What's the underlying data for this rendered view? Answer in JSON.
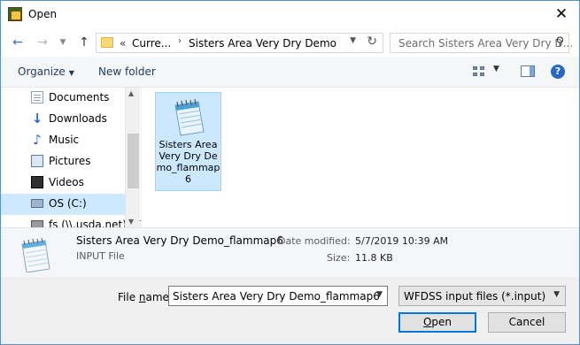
{
  "window": {
    "title": "Open",
    "close_glyph": "✕"
  },
  "nav": {
    "breadcrumb_prefix": "«",
    "breadcrumb_parent": "Curre...",
    "breadcrumb_separator": "›",
    "breadcrumb_current": "Sisters Area Very Dry Demo",
    "search_placeholder": "Search Sisters Area Very Dry D..."
  },
  "toolbar": {
    "organize_label": "Organize",
    "new_folder_label": "New folder",
    "help_glyph": "?"
  },
  "sidebar": {
    "items": [
      {
        "label": "Documents",
        "icon": "documents-icon"
      },
      {
        "label": "Downloads",
        "icon": "downloads-icon"
      },
      {
        "label": "Music",
        "icon": "music-icon"
      },
      {
        "label": "Pictures",
        "icon": "pictures-icon"
      },
      {
        "label": "Videos",
        "icon": "videos-icon"
      },
      {
        "label": "OS (C:)",
        "icon": "drive-icon",
        "selected": true
      },
      {
        "label": "fs (\\\\.usda.net) (T",
        "icon": "network-drive-icon"
      }
    ]
  },
  "files": [
    {
      "name": "Sisters Area Very Dry Demo_flammap6",
      "icon": "notepad-file-icon",
      "selected": true
    }
  ],
  "details": {
    "name": "Sisters Area Very Dry Demo_flammap6",
    "type": "INPUT File",
    "date_label": "Date modified:",
    "date_value": "5/7/2019 10:39 AM",
    "size_label": "Size:",
    "size_value": "11.8 KB"
  },
  "bottom": {
    "file_name_label_pre": "File ",
    "file_name_label_u": "n",
    "file_name_label_post": "ame:",
    "file_name_value": "Sisters Area Very Dry Demo_flammap6",
    "filter_value": "WFDSS input files (*.input)",
    "open_label_u": "O",
    "open_label_rest": "pen",
    "cancel_label": "Cancel"
  },
  "colors": {
    "selection": "#cce8ff",
    "accent": "#0078d7",
    "nav_selected": "#cde8ff"
  }
}
